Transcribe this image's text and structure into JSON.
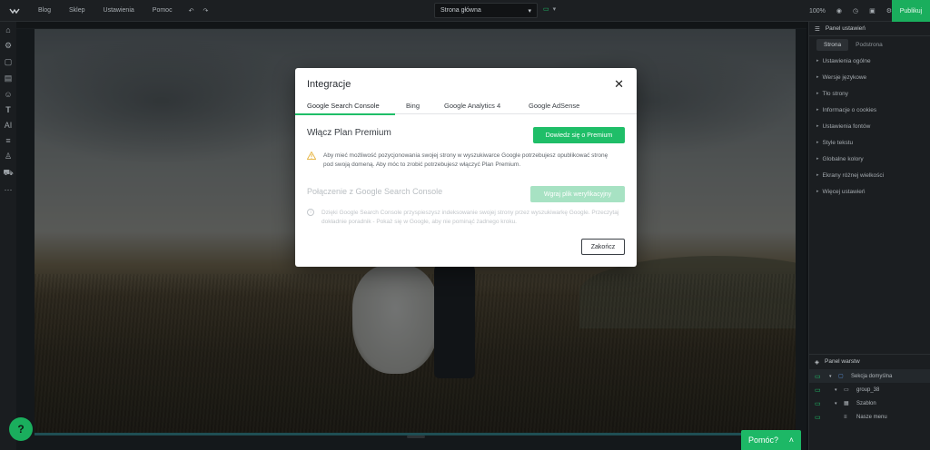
{
  "topbar": {
    "menu": [
      "Blog",
      "Sklep",
      "Ustawienia",
      "Pomoc"
    ],
    "page_select": "Strona główna",
    "zoom": "100%",
    "publish_label": "Publikuj"
  },
  "right_panel": {
    "title": "Panel ustawień",
    "tabs": [
      "Strona",
      "Podstrona"
    ],
    "items": [
      "Ustawienia ogólne",
      "Wersje językowe",
      "Tło strony",
      "Informacje o cookies",
      "Ustawienia fontów",
      "Style tekstu",
      "Globalne kolory",
      "Ekrany różnej wielkości",
      "Więcej ustawień"
    ]
  },
  "layers": {
    "title": "Panel warstw",
    "items": [
      "Sekcja domyślna",
      "group_38",
      "Szablon",
      "Nasze menu"
    ]
  },
  "help_label": "Pomóc?",
  "modal": {
    "title": "Integracje",
    "tabs": [
      "Google Search Console",
      "Bing",
      "Google Analytics 4",
      "Google AdSense"
    ],
    "premium_heading": "Włącz Plan Premium",
    "premium_button": "Dowiedz się o Premium",
    "warning_text": "Aby mieć możliwość pozycjonowania swojej strony w wyszukiwarce Google potrzebujesz opublikować stronę pod swoją domeną. Aby móc to zrobić potrzebujesz włączyć Plan Premium.",
    "connect_heading": "Połączenie z Google Search Console",
    "verify_button": "Wgraj plik weryfikacyjny",
    "info_text": "Dzięki Google Search Console przyspieszysz indeksowanie swojej strony przez wyszukiwarkę Google. Przeczytaj dokładnie poradnik - Pokaż się w Google, aby nie pominąć żadnego kroku.",
    "finish_button": "Zakończ"
  },
  "colors": {
    "accent": "#1fbe68",
    "accent_disabled": "#a7e2c3",
    "warning": "#e8b84a"
  }
}
